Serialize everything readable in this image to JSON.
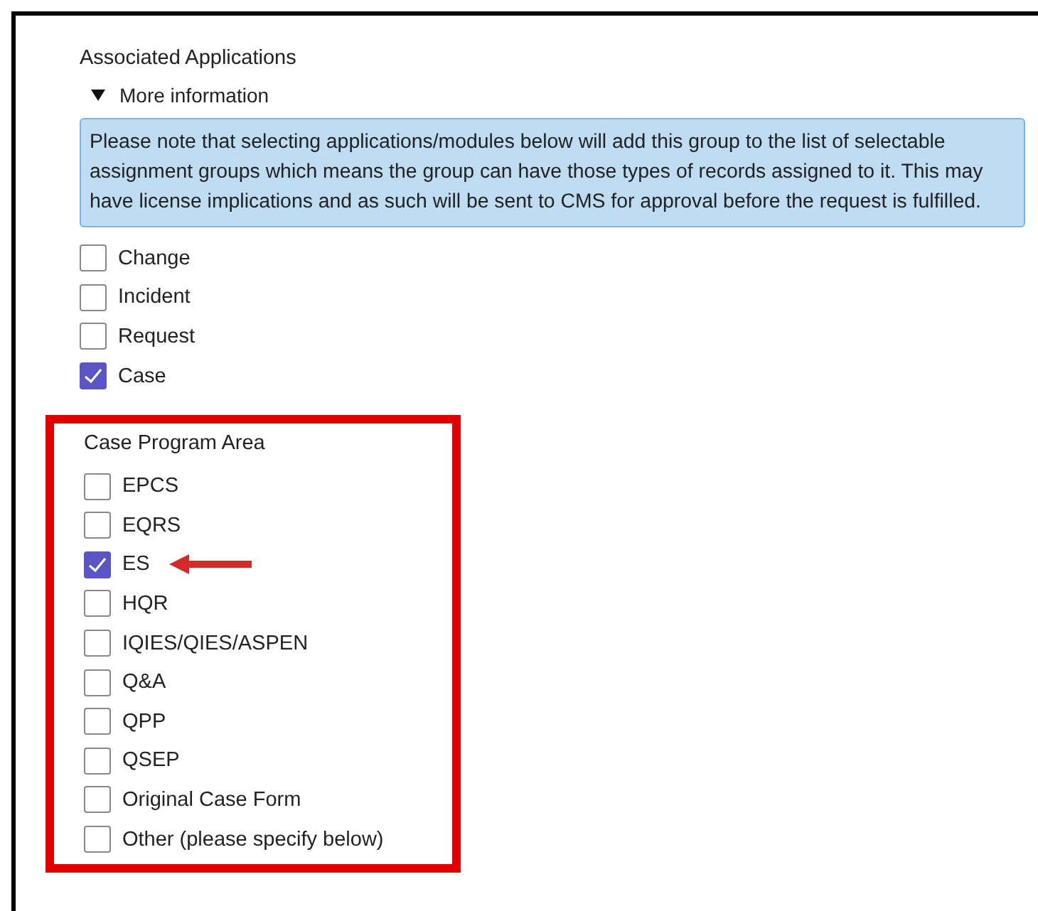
{
  "section_title": "Associated Applications",
  "disclosure": {
    "label": "More information",
    "expanded": true
  },
  "info_note": "Please note that selecting applications/modules below will add this group to the list of selectable assignment groups which means the group can have those types of records assigned to it. This may have license implications and as such will be sent to CMS for approval before the request is fulfilled.",
  "applications": [
    {
      "label": "Change",
      "checked": false
    },
    {
      "label": "Incident",
      "checked": false
    },
    {
      "label": "Request",
      "checked": false
    },
    {
      "label": "Case",
      "checked": true
    }
  ],
  "program_area": {
    "title": "Case Program Area",
    "highlighted": true,
    "items": [
      {
        "label": "EPCS",
        "checked": false,
        "arrow": false
      },
      {
        "label": "EQRS",
        "checked": false,
        "arrow": false
      },
      {
        "label": "ES",
        "checked": true,
        "arrow": true
      },
      {
        "label": "HQR",
        "checked": false,
        "arrow": false
      },
      {
        "label": "IQIES/QIES/ASPEN",
        "checked": false,
        "arrow": false
      },
      {
        "label": "Q&A",
        "checked": false,
        "arrow": false
      },
      {
        "label": "QPP",
        "checked": false,
        "arrow": false
      },
      {
        "label": "QSEP",
        "checked": false,
        "arrow": false
      },
      {
        "label": "Original Case Form",
        "checked": false,
        "arrow": false
      },
      {
        "label": "Other (please specify below)",
        "checked": false,
        "arrow": false
      }
    ]
  }
}
